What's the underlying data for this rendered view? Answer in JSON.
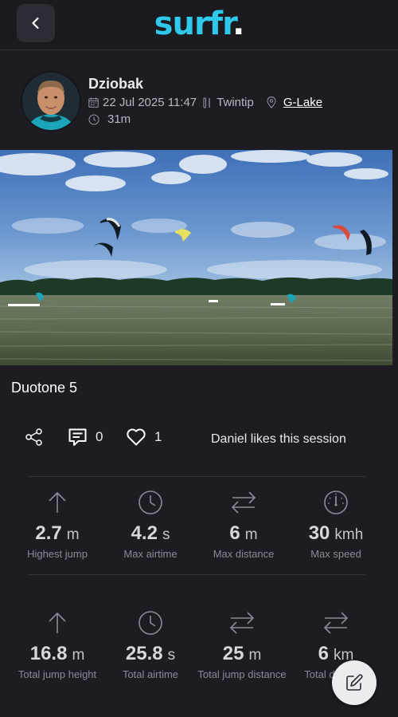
{
  "header": {
    "logo_text": "surfr",
    "logo_dot": "."
  },
  "profile": {
    "username": "Dziobak",
    "datetime": "22 Jul 2025 11:47",
    "board": "Twintip",
    "location": "G-Lake",
    "duration": "31m"
  },
  "session": {
    "caption": "Duotone 5"
  },
  "actions": {
    "comments_count": "0",
    "likes_count": "1",
    "likes_text": "Daniel likes this session"
  },
  "stats_top": [
    {
      "value": "2.7",
      "unit": "m",
      "label": "Highest jump",
      "icon": "arrow-up-icon"
    },
    {
      "value": "4.2",
      "unit": "s",
      "label": "Max airtime",
      "icon": "clock-icon"
    },
    {
      "value": "6",
      "unit": "m",
      "label": "Max distance",
      "icon": "arrows-swap-icon"
    },
    {
      "value": "30",
      "unit": "kmh",
      "label": "Max speed",
      "icon": "speedometer-icon"
    }
  ],
  "stats_bottom": [
    {
      "value": "16.8",
      "unit": "m",
      "label": "Total jump height",
      "icon": "arrow-up-icon"
    },
    {
      "value": "25.8",
      "unit": "s",
      "label": "Total airtime",
      "icon": "clock-icon"
    },
    {
      "value": "25",
      "unit": "m",
      "label": "Total jump distance",
      "icon": "arrows-swap-icon"
    },
    {
      "value": "6",
      "unit": "km",
      "label": "Total distance",
      "icon": "arrows-swap-icon"
    }
  ],
  "colors": {
    "brand": "#2fc9ec",
    "background": "#1c1c22",
    "fab": "#ececef"
  }
}
